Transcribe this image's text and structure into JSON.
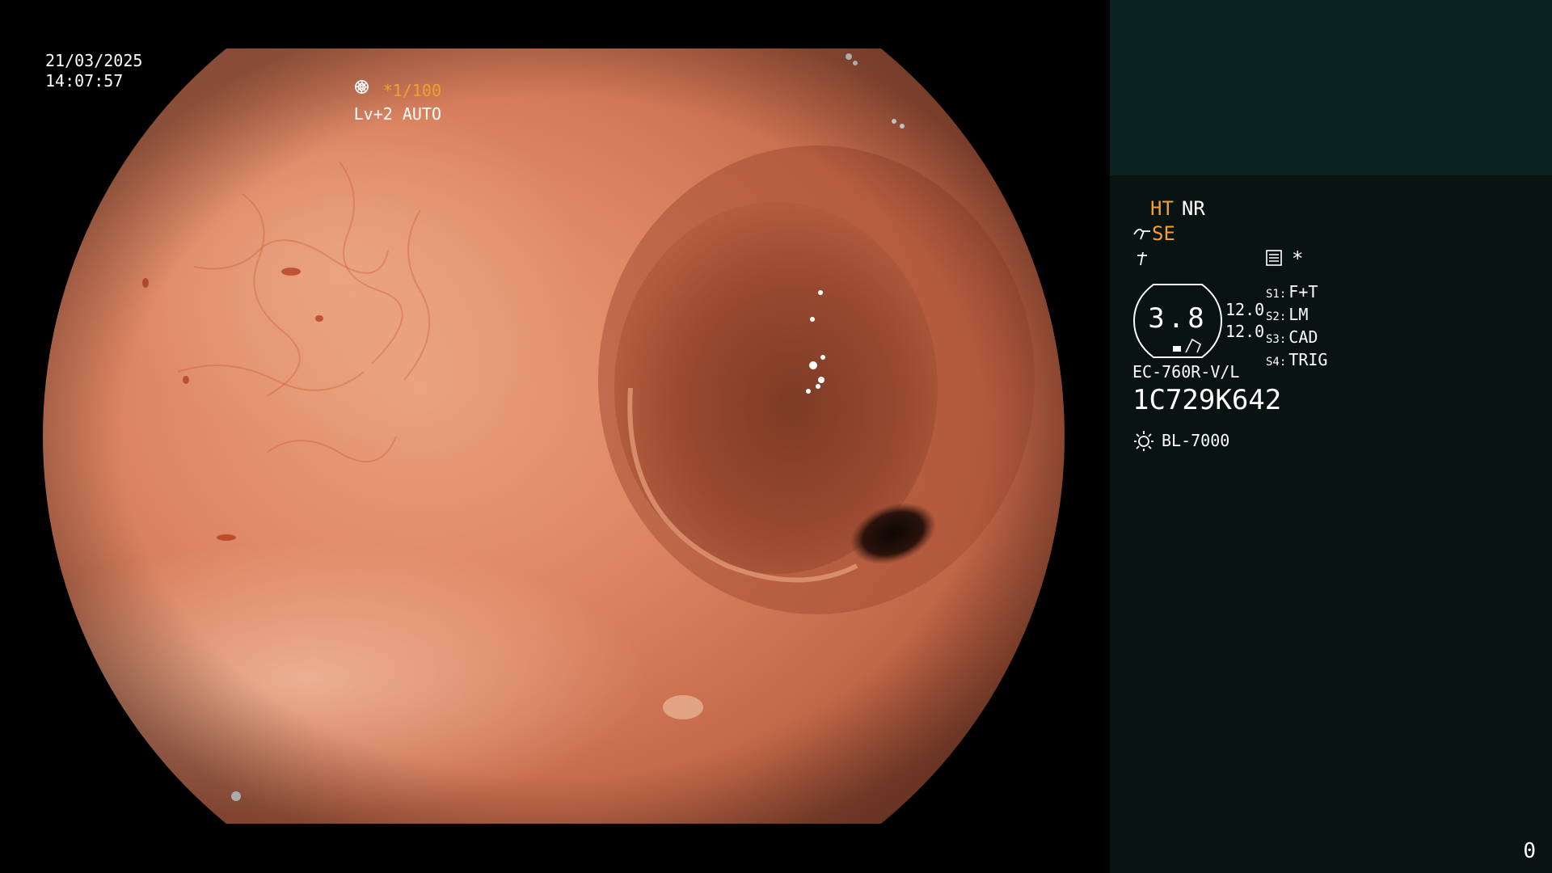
{
  "overlay": {
    "date": "21/03/2025",
    "time": "14:07:57",
    "shutter": "*1/100",
    "shutter_icon": "aperture-icon",
    "iris": "Lv+2 AUTO",
    "iris_icon": "iris-icon"
  },
  "panel": {
    "modes": [
      "HT",
      "NR"
    ],
    "mode_colors": [
      "#f2a12e",
      "#ffffff"
    ],
    "se_label": "SE",
    "se_icon": "scope-bend-icon",
    "flash_icon": "freeze-icon",
    "memo_icon": "memo-icon",
    "star": "*",
    "gauge_value": "3.8",
    "values": [
      "12.0",
      "12.0"
    ],
    "switches": [
      {
        "key": "S1:",
        "value": "F+T"
      },
      {
        "key": "S2:",
        "value": "LM"
      },
      {
        "key": "S3:",
        "value": "CAD"
      },
      {
        "key": "S4:",
        "value": "TRIG"
      }
    ],
    "scope_model": "EC-760R-V/L",
    "scope_serial": "1C729K642",
    "light_source": "BL-7000",
    "light_icon": "light-source-icon",
    "page_number": "0"
  },
  "colors": {
    "accent_orange": "#f2a12e",
    "panel_bg": "#081312",
    "thumb_bg": "#0c2323"
  }
}
